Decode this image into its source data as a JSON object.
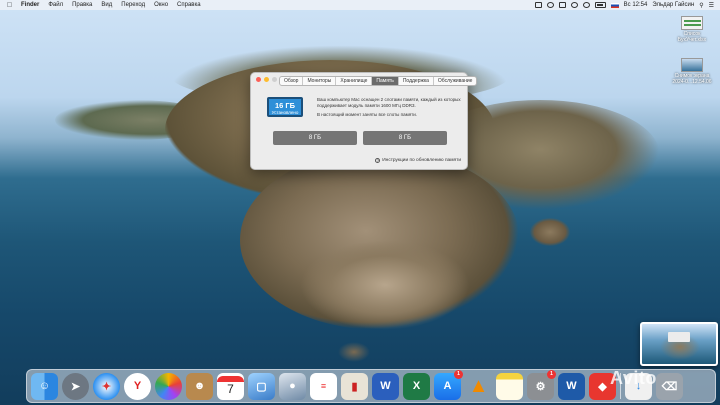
{
  "menubar": {
    "app": "Finder",
    "items": [
      "Файл",
      "Правка",
      "Вид",
      "Переход",
      "Окно",
      "Справка"
    ],
    "clock": "Вс 12:54",
    "user": "Эльдар Гайсин"
  },
  "window": {
    "tabs": [
      "Обзор",
      "Мониторы",
      "Хранилище",
      "Память",
      "Поддержка",
      "Обслуживание"
    ],
    "active_tab": "Память",
    "memory_size": "16 ГБ",
    "memory_status": "Установлено",
    "info_line1": "Ваш компьютер Mac оснащен 2 слотами памяти, каждый из которых поддерживает модуль памяти 1600 МГц DDR3.",
    "info_line2": "В настоящий момент заняты все слоты памяти.",
    "slots": [
      "8 ГБ",
      "8 ГБ"
    ],
    "help_link": "Инструкции по обновлению памяти"
  },
  "desktop": {
    "file1": "Список БухУчет.xlsx",
    "file2": "Снимок экрана 2024-0...12.54.06"
  },
  "dock": {
    "apps": [
      "finder",
      "launchpad",
      "safari",
      "yandex",
      "photos",
      "contacts",
      "calendar",
      "preview",
      "image-capture",
      "reminders",
      "books",
      "word",
      "excel",
      "app-store",
      "vlc",
      "notes",
      "system-preferences",
      "w-app",
      "anydesk"
    ],
    "calendar_day": "7",
    "appstore_badge": "1",
    "sysprefs_badge": "1"
  },
  "watermark": "Avito",
  "colors": {
    "chip": "#2e8fd8",
    "slot": "#757575",
    "active_tab": "#6b6b6b"
  }
}
